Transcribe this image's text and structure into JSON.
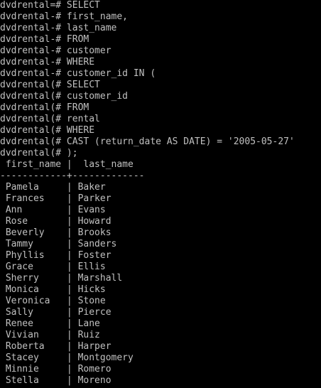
{
  "terminal": {
    "prompt_lines": [
      "dvdrental=# SELECT",
      "dvdrental-# first_name,",
      "dvdrental-# last_name",
      "dvdrental-# FROM",
      "dvdrental-# customer",
      "dvdrental-# WHERE",
      "dvdrental-# customer_id IN (",
      "dvdrental(# SELECT",
      "dvdrental(# customer_id",
      "dvdrental(# FROM",
      "dvdrental(# rental",
      "dvdrental(# WHERE",
      "dvdrental(# CAST (return_date AS DATE) = '2005-05-27'",
      "dvdrental(# );"
    ],
    "header": " first_name |  last_name",
    "separator": "------------+-------------",
    "rows": [
      " Pamela     | Baker",
      " Frances    | Parker",
      " Ann        | Evans",
      " Rose       | Howard",
      " Beverly    | Brooks",
      " Tammy      | Sanders",
      " Phyllis    | Foster",
      " Grace      | Ellis",
      " Sherry     | Marshall",
      " Monica     | Hicks",
      " Veronica   | Stone",
      " Sally      | Pierce",
      " Renee      | Lane",
      " Vivian     | Ruiz",
      " Roberta    | Harper",
      " Stacey     | Montgomery",
      " Minnie     | Romero",
      " Stella     | Moreno"
    ],
    "colors": {
      "background": "#000000",
      "text": "#c0c0c0"
    }
  }
}
